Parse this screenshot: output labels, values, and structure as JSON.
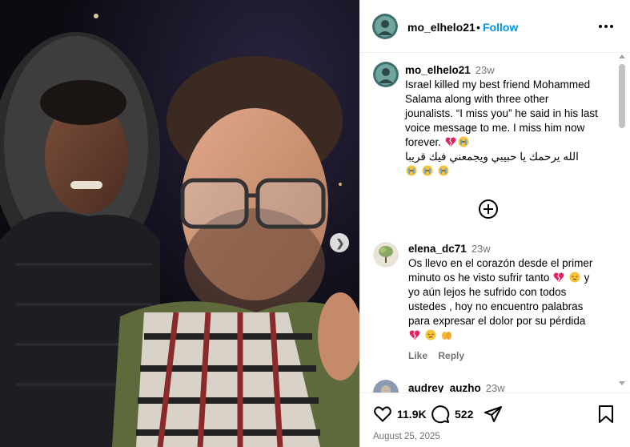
{
  "header": {
    "username": "mo_elhelo21",
    "separator": "•",
    "follow_label": "Follow",
    "more_icon": "more-horizontal-icon"
  },
  "photo": {
    "next_icon": "chevron-right-icon"
  },
  "caption": {
    "username": "mo_elhelo21",
    "time": "23w",
    "line1": "Israel killed my best friend Mohammed",
    "line2": "Salama along with three other",
    "line3": "jounalists. “I miss you” he said in his last",
    "line4": "voice message to me. I miss him now",
    "line5": "forever.",
    "arabic": "الله يرحمك يا حبيبي ويجمعني فيك قريبا",
    "emojis_line5": [
      "broken-heart-emoji",
      "crying-face-emoji"
    ],
    "emojis_arabic": [
      "crying-face-emoji",
      "crying-face-emoji",
      "crying-face-emoji"
    ]
  },
  "load_more_icon": "add-circle-icon",
  "comments": [
    {
      "username": "elena_dc71",
      "time": "23w",
      "line1": "Os llevo en el corazón desde el primer",
      "line2": "minuto os he visto sufrir tanto",
      "line2_end": "y",
      "line3": "yo aún lejos he sufrido con todos",
      "line4": "ustedes , hoy no encuentro palabras",
      "line5": "para expresar el dolor por su pérdida",
      "like_label": "Like",
      "reply_label": "Reply"
    },
    {
      "username": "audrey_auzho",
      "time": "23w"
    }
  ],
  "actions": {
    "like_icon": "heart-icon",
    "like_count": "11.9K",
    "comment_icon": "comment-icon",
    "comment_count": "522",
    "share_icon": "send-icon",
    "save_icon": "bookmark-icon"
  },
  "post_date": "August 25, 2025",
  "colors": {
    "link_blue": "#0095f6",
    "muted_text": "#737373",
    "divider": "#efefef"
  }
}
